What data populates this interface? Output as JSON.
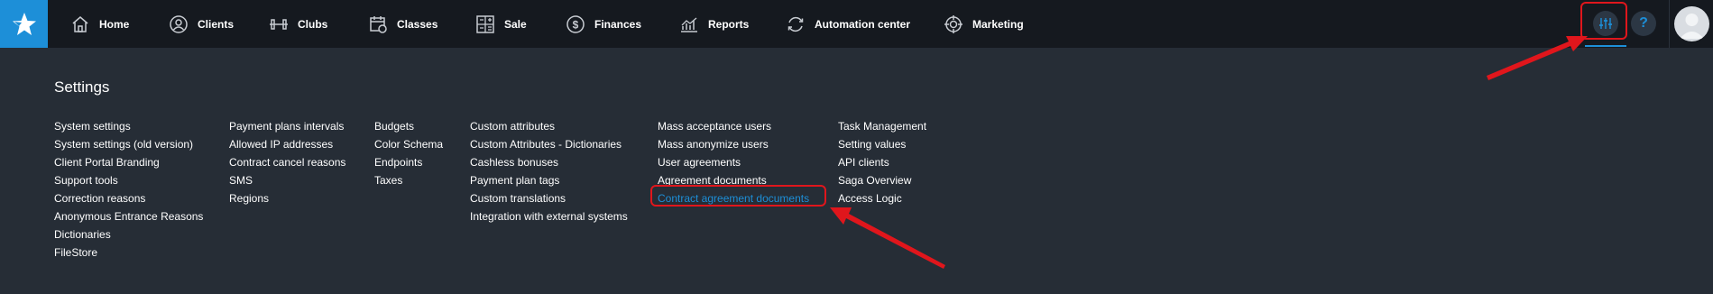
{
  "nav": {
    "items": [
      {
        "label": "Home",
        "icon": "home-icon"
      },
      {
        "label": "Clients",
        "icon": "user-icon"
      },
      {
        "label": "Clubs",
        "icon": "dumbbell-icon"
      },
      {
        "label": "Classes",
        "icon": "calendar-icon"
      },
      {
        "label": "Sale",
        "icon": "calculator-icon"
      },
      {
        "label": "Finances",
        "icon": "dollar-icon"
      },
      {
        "label": "Reports",
        "icon": "chart-icon"
      },
      {
        "label": "Automation center",
        "icon": "sync-icon"
      },
      {
        "label": "Marketing",
        "icon": "target-icon"
      }
    ]
  },
  "tools": {
    "settings_icon": "sliders-icon",
    "help_label": "?",
    "avatar": "avatar"
  },
  "settings": {
    "title": "Settings",
    "columns": [
      [
        "System settings",
        "System settings (old version)",
        "Client Portal Branding",
        "Support tools",
        "Correction reasons",
        "Anonymous Entrance Reasons",
        "Dictionaries",
        "FileStore"
      ],
      [
        "Payment plans intervals",
        "Allowed IP addresses",
        "Contract cancel reasons",
        "SMS",
        "Regions"
      ],
      [
        "Budgets",
        "Color Schema",
        "Endpoints",
        "Taxes"
      ],
      [
        "Custom attributes",
        "Custom Attributes - Dictionaries",
        "Cashless bonuses",
        "Payment plan tags",
        "Custom translations",
        "Integration with external systems"
      ],
      [
        "Mass acceptance users",
        "Mass anonymize users",
        "User agreements",
        "Agreement documents",
        "Contract agreement documents"
      ],
      [
        "Task Management",
        "Setting values",
        "API clients",
        "Saga Overview",
        "Access Logic"
      ]
    ],
    "active_item": "Contract agreement documents"
  },
  "colors": {
    "accent": "#1d8fd8",
    "topbar": "#15191f",
    "panel": "#262d36",
    "annotation": "#e0161c"
  }
}
